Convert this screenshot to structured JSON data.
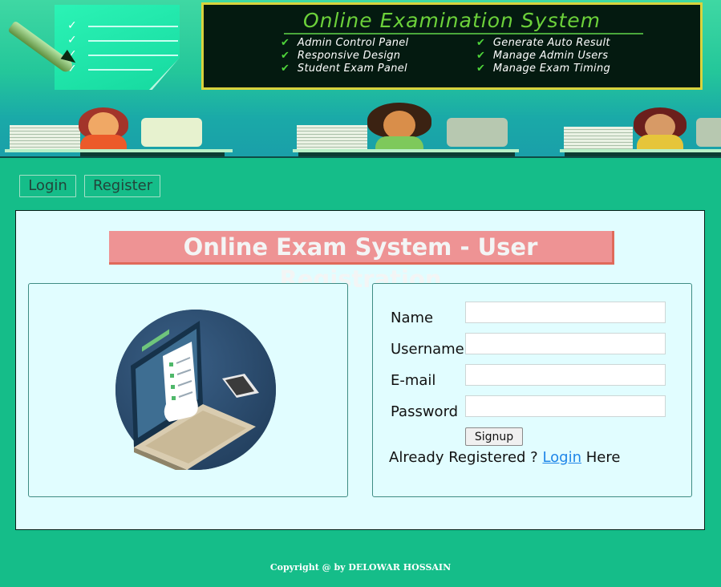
{
  "banner": {
    "board_title": "Online Examination System",
    "features_left": [
      "Admin Control Panel",
      "Responsive Design",
      "Student Exam Panel"
    ],
    "features_right": [
      "Generate Auto Result",
      "Manage Admin Users",
      "Manage Exam Timing"
    ],
    "check_glyph": "✔"
  },
  "nav": {
    "login_label": "Login",
    "register_label": "Register"
  },
  "page": {
    "heading": "Online Exam System - User Registration"
  },
  "form": {
    "name_label": "Name",
    "username_label": "Username",
    "email_label": "E-mail",
    "password_label": "Password",
    "name_value": "",
    "username_value": "",
    "email_value": "",
    "password_value": "",
    "signup_label": "Signup",
    "already_text": "Already Registered ? ",
    "login_link": "Login",
    "here_text": " Here"
  },
  "footer": {
    "copyright": "Copyright @ by DELOWAR HOSSAIN"
  },
  "colors": {
    "background": "#15bd89",
    "panel_bg": "#e1fdff",
    "heading_bg": "#ee9394",
    "heading_shadow": "#e06a5a",
    "link": "#1f86e8",
    "board_title": "#6cd13a"
  }
}
